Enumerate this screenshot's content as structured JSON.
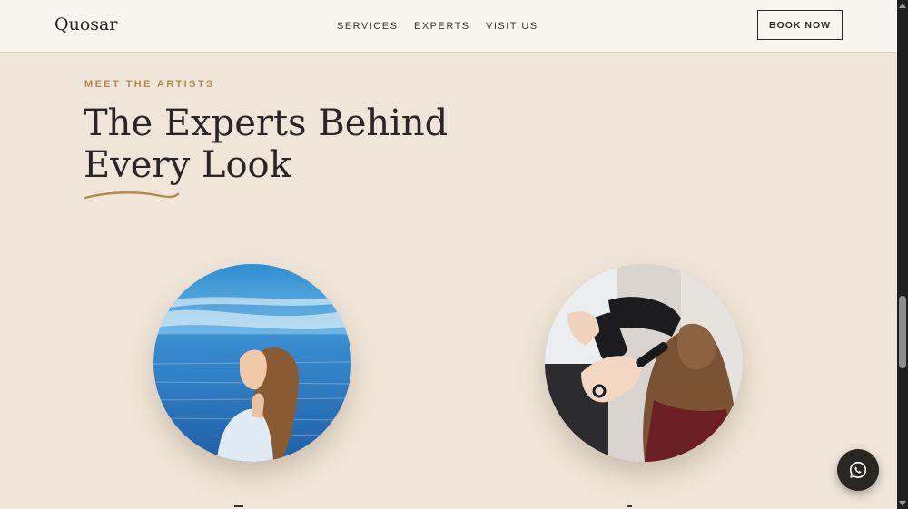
{
  "header": {
    "logo": "Quosar",
    "nav": [
      "SERVICES",
      "EXPERTS",
      "VISIT US"
    ],
    "cta": "BOOK NOW"
  },
  "section": {
    "eyebrow": "MEET THE ARTISTS",
    "title": "The Experts Behind Every Look"
  },
  "portraits": [
    {
      "name": "portrait-woman-by-sea"
    },
    {
      "name": "portrait-hair-styling"
    }
  ],
  "chat_icon": "whatsapp-icon",
  "colors": {
    "background": "#efe5d8",
    "header": "#f8f4ee",
    "accent": "#b08a4c",
    "text": "#2b2623"
  }
}
